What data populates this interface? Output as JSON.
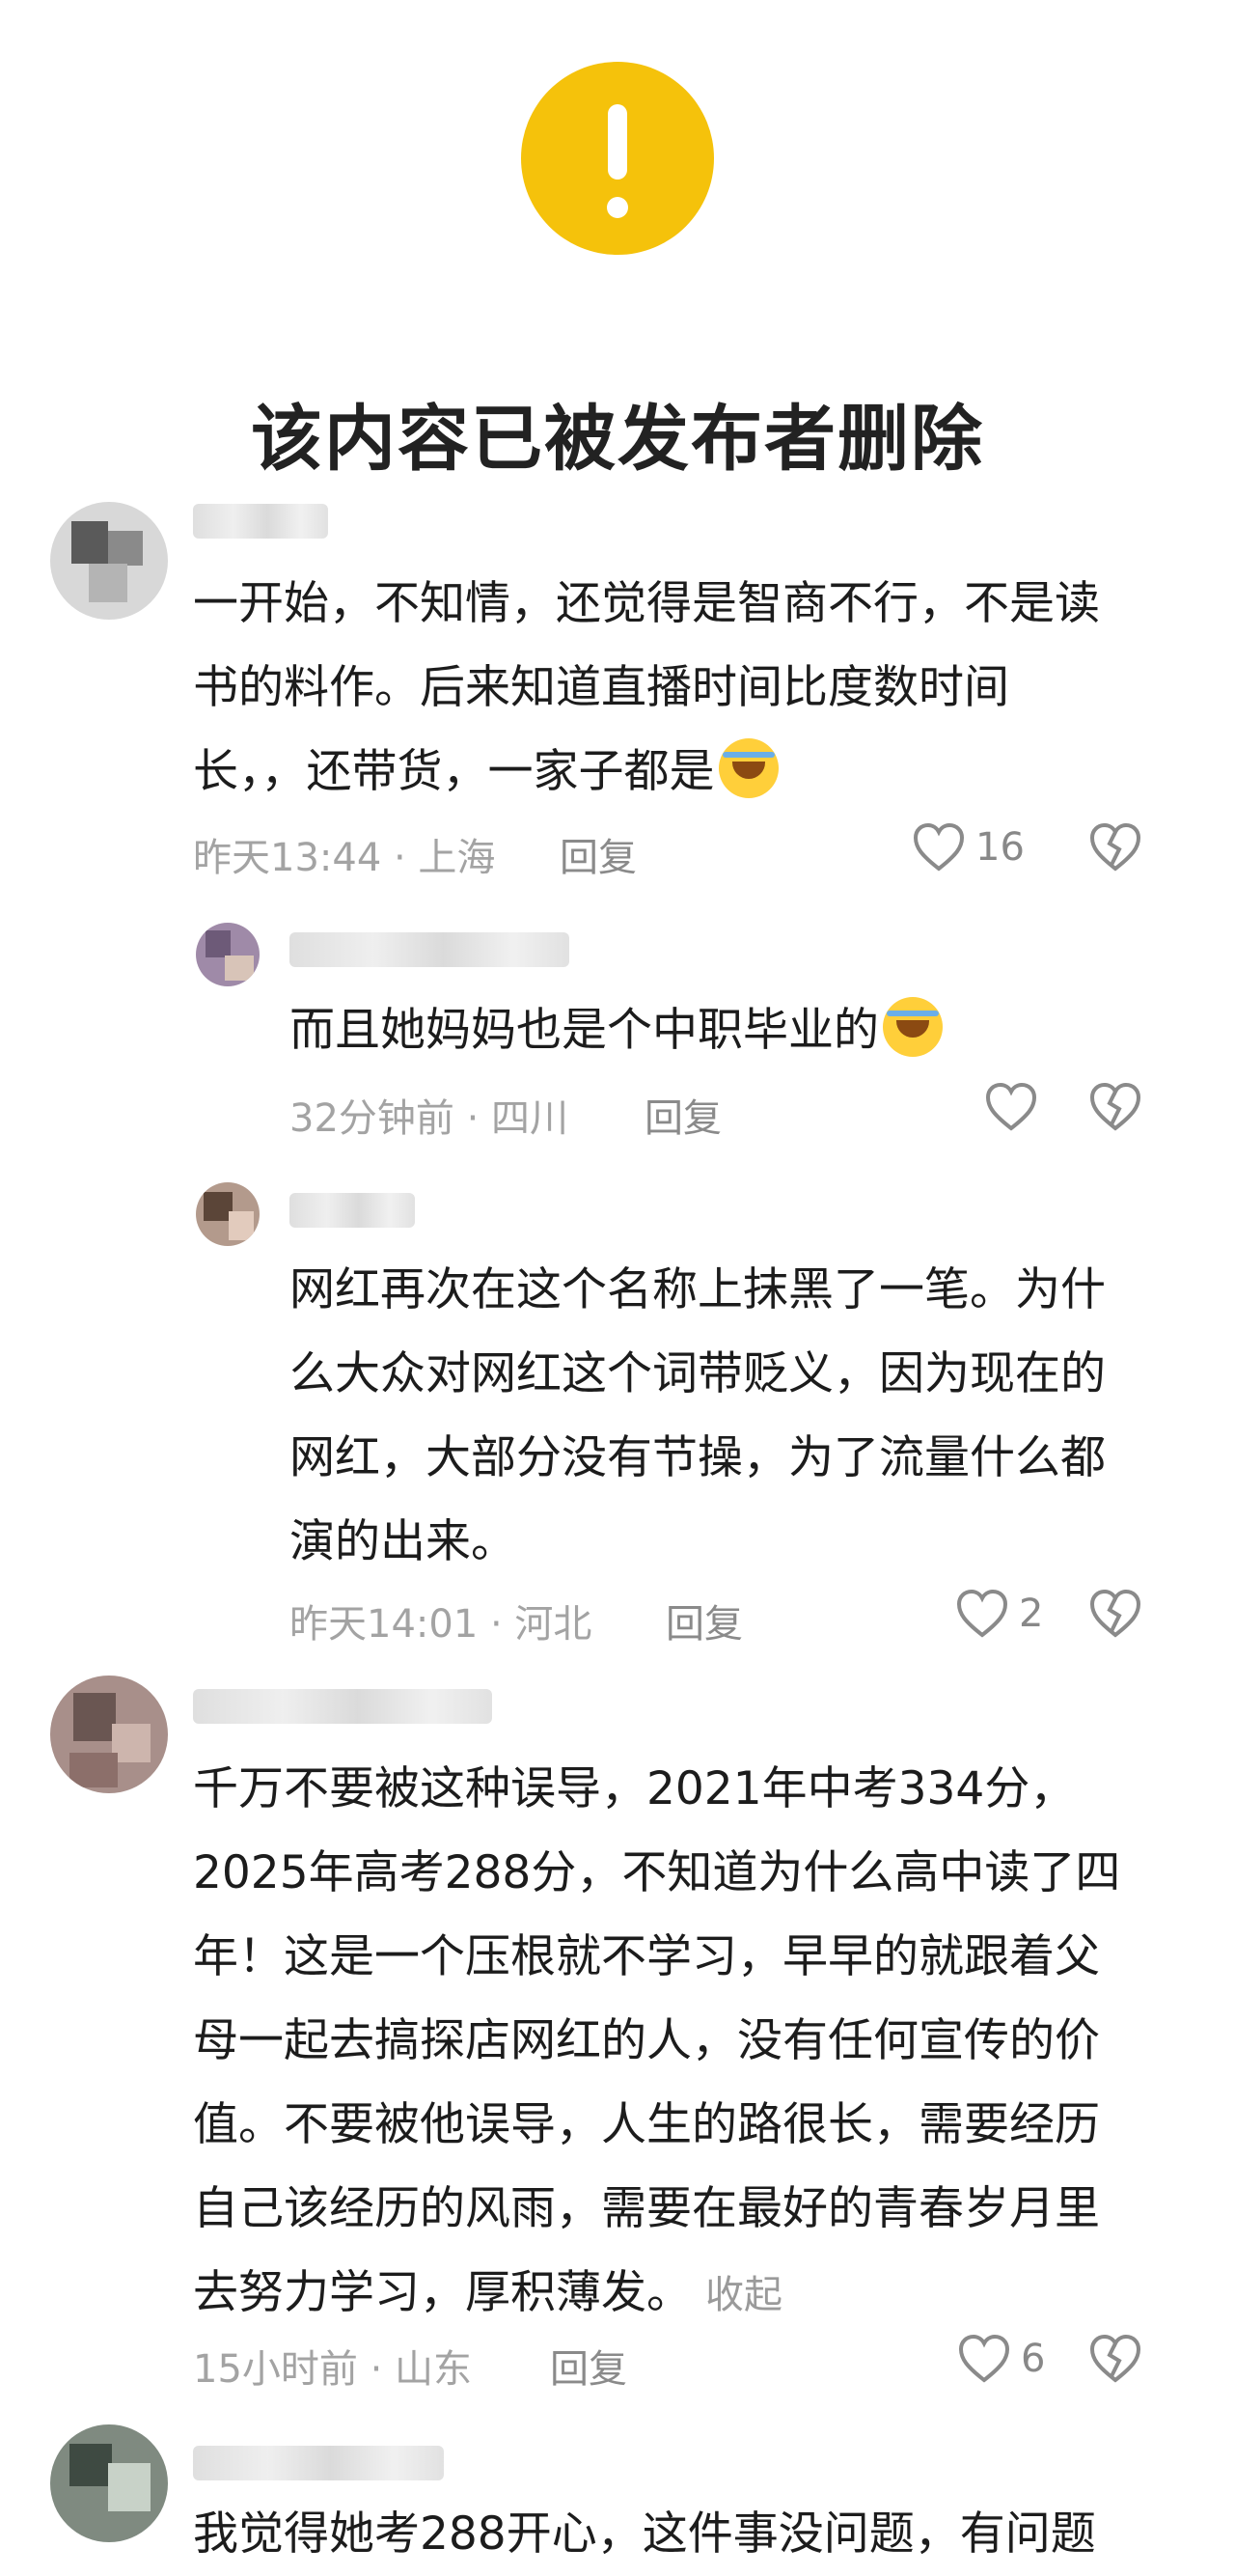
{
  "deleted_notice": {
    "icon": "exclamation-icon",
    "title": "该内容已被发布者删除",
    "accent": "#f5c20b"
  },
  "comments": [
    {
      "lines": [
        "一开始，不知情，还觉得是智商不行，不是读",
        "书的料作。后来知道直播时间比度数时间",
        "长，，还带货，一家子都是"
      ],
      "emoji": "laughing-crying-emoji",
      "meta": "昨天13:44 · 上海",
      "reply": "回复",
      "likes": "16"
    },
    {
      "lines": [
        "而且她妈妈也是个中职毕业的"
      ],
      "emoji": "sweating-emoji",
      "meta": "32分钟前 · 四川",
      "reply": "回复",
      "likes": ""
    },
    {
      "lines": [
        "网红再次在这个名称上抹黑了一笔。为什",
        "么大众对网红这个词带贬义，因为现在的",
        "网红，大部分没有节操，为了流量什么都",
        "演的出来。"
      ],
      "meta": "昨天14:01 · 河北",
      "reply": "回复",
      "likes": "2"
    },
    {
      "lines": [
        "千万不要被这种误导，2021年中考334分，",
        "2025年高考288分，不知道为什么高中读了四",
        "年！这是一个压根就不学习，早早的就跟着父",
        "母一起去搞探店网红的人，没有任何宣传的价",
        "值。不要被他误导，人生的路很长，需要经历",
        "自己该经历的风雨，需要在最好的青春岁月里",
        "去努力学习，厚积薄发。"
      ],
      "fold": "收起",
      "meta": "15小时前 · 山东",
      "reply": "回复",
      "likes": "6"
    },
    {
      "lines": [
        "我觉得她考288开心，这件事没问题，有问题"
      ]
    }
  ]
}
